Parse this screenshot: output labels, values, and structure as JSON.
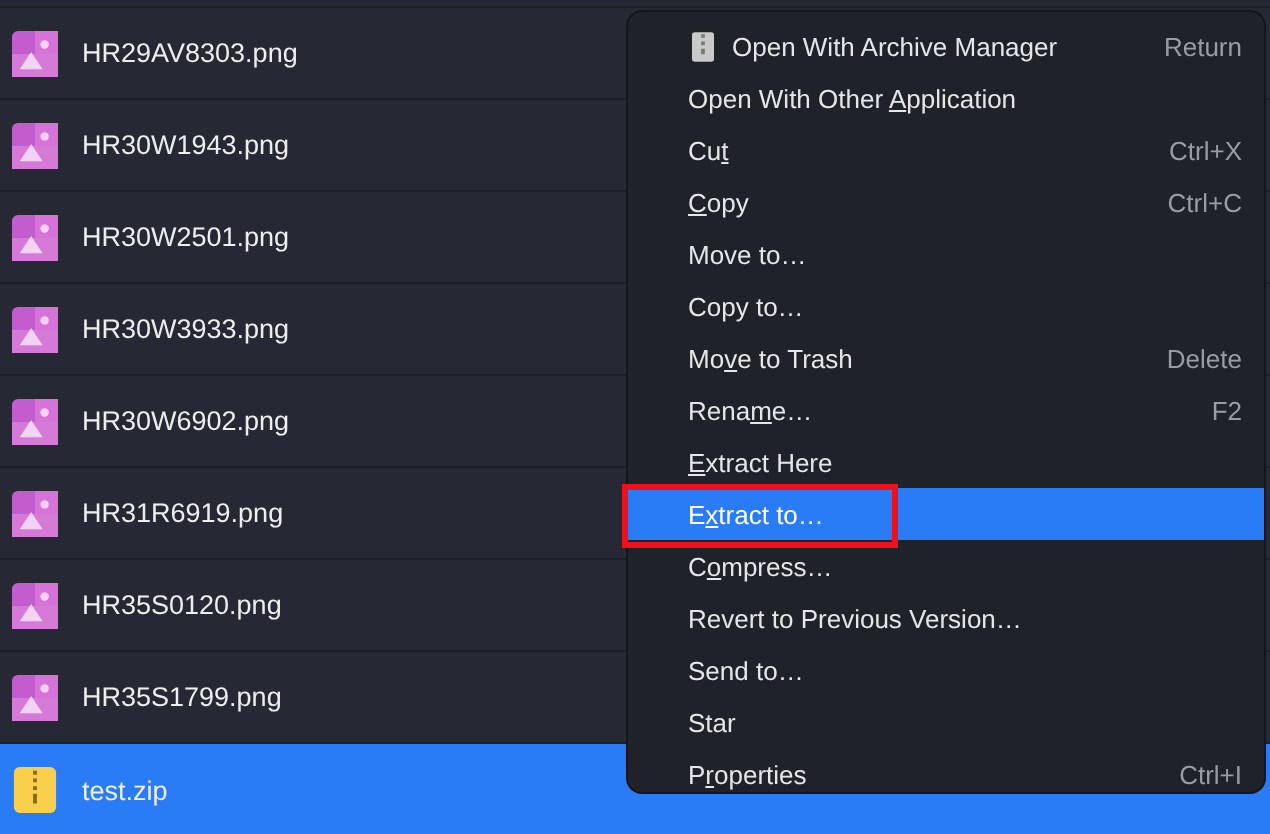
{
  "files": [
    {
      "name": "HR29AV8303.png",
      "kind": "image",
      "selected": false
    },
    {
      "name": "HR30W1943.png",
      "kind": "image",
      "selected": false
    },
    {
      "name": "HR30W2501.png",
      "kind": "image",
      "selected": false
    },
    {
      "name": "HR30W3933.png",
      "kind": "image",
      "selected": false
    },
    {
      "name": "HR30W6902.png",
      "kind": "image",
      "selected": false
    },
    {
      "name": "HR31R6919.png",
      "kind": "image",
      "selected": false
    },
    {
      "name": "HR35S0120.png",
      "kind": "image",
      "selected": false
    },
    {
      "name": "HR35S1799.png",
      "kind": "image",
      "selected": false
    },
    {
      "name": "test.zip",
      "kind": "archive",
      "selected": true
    }
  ],
  "context_menu": {
    "items": [
      {
        "kind": "app",
        "label": {
          "after": "Open With Archive Manager"
        },
        "shortcut": "Return",
        "selected": false,
        "annotated": false
      },
      {
        "kind": "command",
        "label": {
          "before": "Open With Other ",
          "key": "A",
          "after": "pplication"
        },
        "selected": false,
        "annotated": false
      },
      {
        "kind": "command",
        "label": {
          "before": "Cu",
          "key": "t"
        },
        "shortcut": "Ctrl+X",
        "selected": false,
        "annotated": false
      },
      {
        "kind": "command",
        "label": {
          "key": "C",
          "after": "opy"
        },
        "shortcut": "Ctrl+C",
        "selected": false,
        "annotated": false
      },
      {
        "kind": "command",
        "label": {
          "after": "Move to…"
        },
        "selected": false,
        "annotated": false
      },
      {
        "kind": "command",
        "label": {
          "after": "Copy to…"
        },
        "selected": false,
        "annotated": false
      },
      {
        "kind": "command",
        "label": {
          "before": "Mo",
          "key": "v",
          "after": "e to Trash"
        },
        "shortcut": "Delete",
        "selected": false,
        "annotated": false
      },
      {
        "kind": "command",
        "label": {
          "before": "Rena",
          "key": "m",
          "after": "e…"
        },
        "shortcut": "F2",
        "selected": false,
        "annotated": false
      },
      {
        "kind": "command",
        "label": {
          "key": "E",
          "after": "xtract Here"
        },
        "selected": false,
        "annotated": false
      },
      {
        "kind": "command",
        "label": {
          "before": "E",
          "key": "x",
          "after": "tract to…"
        },
        "selected": true,
        "annotated": true
      },
      {
        "kind": "command",
        "label": {
          "before": "C",
          "key": "o",
          "after": "mpress…"
        },
        "selected": false,
        "annotated": false
      },
      {
        "kind": "command",
        "label": {
          "after": "Revert to Previous Version…"
        },
        "selected": false,
        "annotated": false
      },
      {
        "kind": "command",
        "label": {
          "after": "Send to…"
        },
        "selected": false,
        "annotated": false
      },
      {
        "kind": "command",
        "label": {
          "after": "Star"
        },
        "selected": false,
        "annotated": false
      },
      {
        "kind": "command",
        "label": {
          "before": "P",
          "key": "r",
          "after": "operties"
        },
        "shortcut": "Ctrl+I",
        "selected": false,
        "annotated": false
      }
    ]
  }
}
